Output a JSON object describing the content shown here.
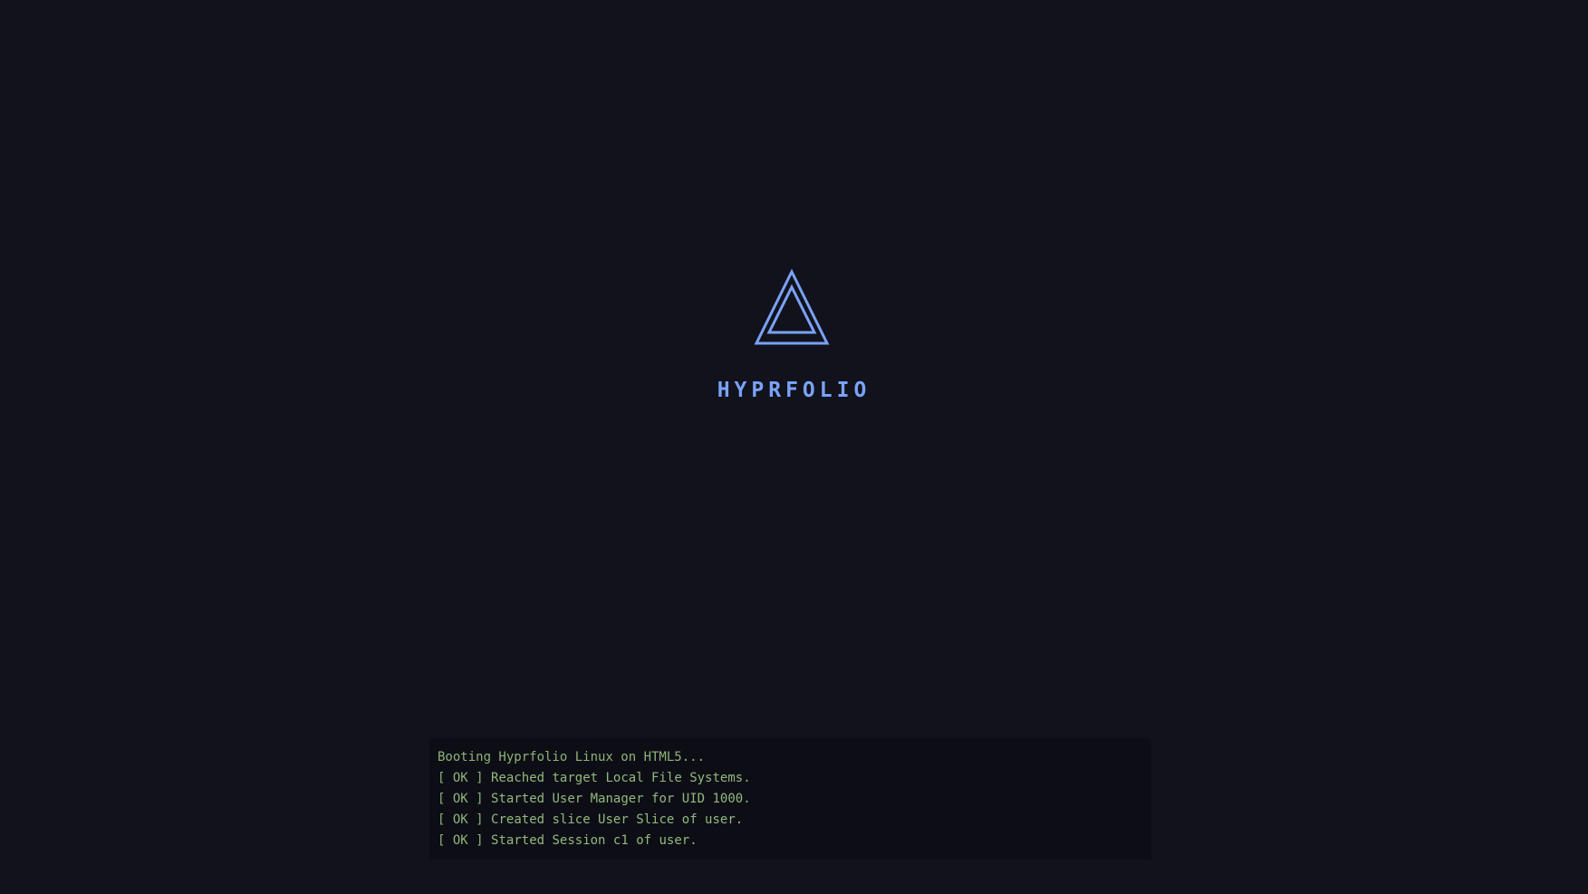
{
  "brand": {
    "logo_icon": "double-triangle-icon",
    "name": "HYPRFOLIO",
    "accent_color": "#7aa2f7"
  },
  "boot_log": {
    "header": "Booting Hyprfolio Linux on HTML5...",
    "status_open": "[",
    "status_word": "OK",
    "status_close": "]",
    "text_color": "#8fb37a",
    "lines": [
      {
        "message": "Reached target Local File Systems."
      },
      {
        "message": "Started User Manager for UID 1000."
      },
      {
        "message": "Created slice User Slice of user."
      },
      {
        "message": "Started Session c1 of user."
      }
    ]
  },
  "background_color": "#11121c"
}
